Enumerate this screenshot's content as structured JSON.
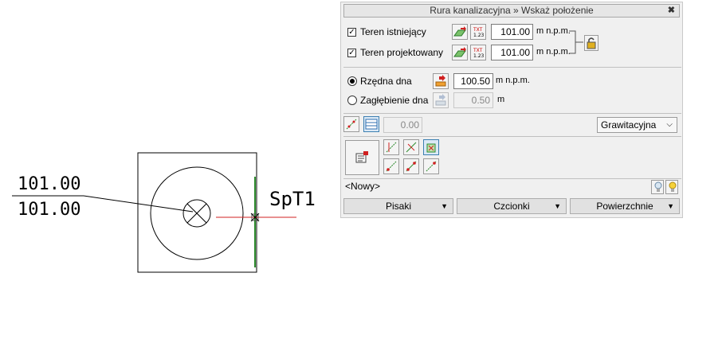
{
  "drawing": {
    "top_value": "101.00",
    "bottom_value": "101.00",
    "node_label": "SpT1"
  },
  "panel": {
    "title": "Rura kanalizacyjna » Wskaż położenie",
    "close_glyph": "✖",
    "terrain_existing": {
      "label": "Teren istniejący",
      "checked": true,
      "value": "101.00",
      "unit": "m n.p.m."
    },
    "terrain_designed": {
      "label": "Teren projektowany",
      "checked": true,
      "value": "101.00",
      "unit": "m n.p.m."
    },
    "txt_icon_text": "TXT\n1.23",
    "bottom_level": {
      "label": "Rzędna dna",
      "selected": true,
      "value": "100.50",
      "unit": "m n.p.m."
    },
    "depth": {
      "label": "Zagłębienie dna",
      "selected": false,
      "value": "0.50",
      "unit": "m"
    },
    "slope_value": "0.00",
    "flow_type": "Grawitacyjna",
    "name_field": "<Nowy>",
    "buttons": {
      "pens": "Pisaki",
      "fonts": "Czcionki",
      "surfaces": "Powierzchnie"
    },
    "colors": {
      "accent_green": "#2c8a2c",
      "accent_red": "#d02020",
      "accent_blue": "#2f6fb0"
    }
  }
}
